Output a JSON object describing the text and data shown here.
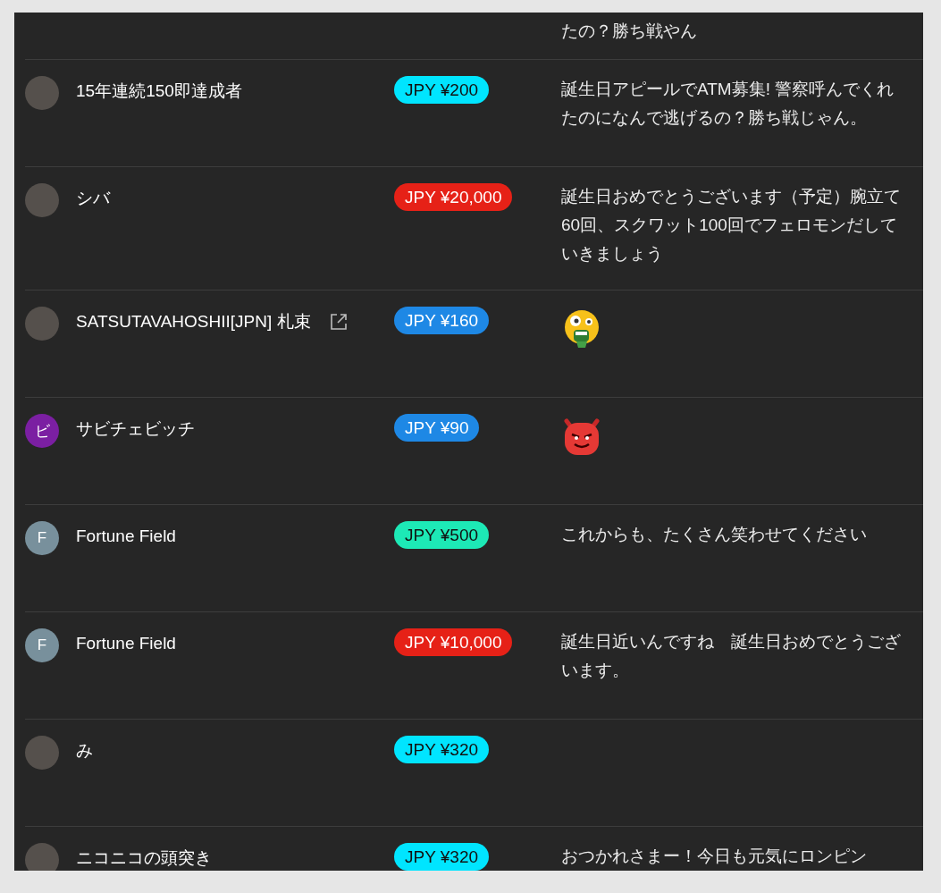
{
  "rows": [
    {
      "partial": true,
      "message": {
        "kind": "text",
        "text": "たの？勝ち戦やん"
      }
    },
    {
      "avatar": {
        "kind": "photo"
      },
      "name": "15年連続150即達成者",
      "external_link": false,
      "amount": {
        "text": "JPY ¥200",
        "color": "#00e5ff"
      },
      "message": {
        "kind": "text",
        "text": "誕生日アピールでATM募集! 警察呼んでくれたのになんで逃げるの？勝ち戦じゃん。"
      }
    },
    {
      "avatar": {
        "kind": "photo"
      },
      "name": "シバ",
      "external_link": false,
      "amount": {
        "text": "JPY ¥20,000",
        "color": "#e62117"
      },
      "message": {
        "kind": "text",
        "text": "誕生日おめでとうございます（予定）腕立て60回、スクワット100回でフェロモンだしていきましょう"
      }
    },
    {
      "avatar": {
        "kind": "photo"
      },
      "name": "SATSUTAVAHOSHII[JPN] 札束",
      "external_link": true,
      "amount": {
        "text": "JPY ¥160",
        "color": "#1e88e5"
      },
      "message": {
        "kind": "vomit-emoji"
      }
    },
    {
      "avatar": {
        "kind": "letter",
        "letter": "ビ",
        "color": "#7b1fa2"
      },
      "name": "サビチェビッチ",
      "external_link": false,
      "amount": {
        "text": "JPY ¥90",
        "color": "#1e88e5"
      },
      "message": {
        "kind": "devil-emoji"
      }
    },
    {
      "avatar": {
        "kind": "letter",
        "letter": "F",
        "color": "#78909c"
      },
      "name": "Fortune Field",
      "external_link": false,
      "amount": {
        "text": "JPY ¥500",
        "color": "#1de9b6"
      },
      "message": {
        "kind": "text",
        "text": "これからも、たくさん笑わせてください"
      }
    },
    {
      "avatar": {
        "kind": "letter",
        "letter": "F",
        "color": "#78909c"
      },
      "name": "Fortune Field",
      "external_link": false,
      "amount": {
        "text": "JPY ¥10,000",
        "color": "#e62117"
      },
      "message": {
        "kind": "text",
        "text": "誕生日近いんですね　誕生日おめでとうございます。"
      }
    },
    {
      "avatar": {
        "kind": "photo"
      },
      "name": "み",
      "external_link": false,
      "amount": {
        "text": "JPY ¥320",
        "color": "#00e5ff"
      },
      "message": {
        "kind": "none"
      }
    },
    {
      "avatar": {
        "kind": "photo"
      },
      "name": "ニコニコの頭突き",
      "external_link": false,
      "amount": {
        "text": "JPY ¥320",
        "color": "#00e5ff"
      },
      "message": {
        "kind": "text",
        "text": "おつかれさまー！今日も元気にロンピン"
      }
    }
  ]
}
